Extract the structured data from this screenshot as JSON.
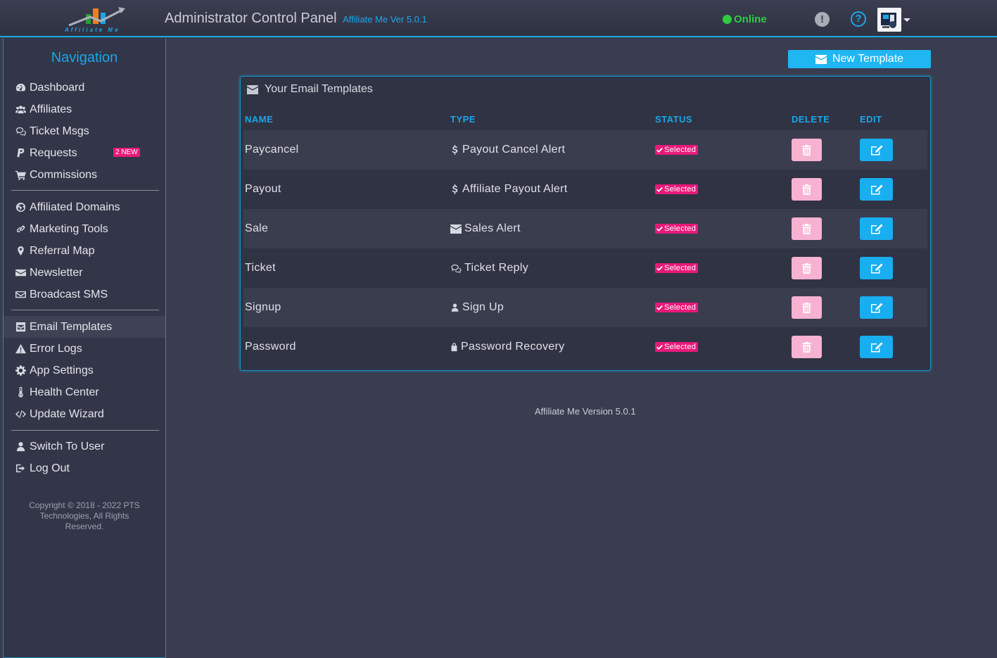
{
  "header": {
    "logo_text": "Affiliate Me",
    "title": "Administrator Control Panel",
    "version_label": "Affiliate Me Ver 5.0.1",
    "status": "Online",
    "status_color": "#2ecc40",
    "accent_color": "#1aa7e8"
  },
  "sidebar": {
    "title": "Navigation",
    "groups": [
      [
        {
          "label": "Dashboard",
          "icon": "dashboard-icon"
        },
        {
          "label": "Affiliates",
          "icon": "users-icon"
        },
        {
          "label": "Ticket Msgs",
          "icon": "comments-icon"
        },
        {
          "label": "Requests",
          "icon": "paypal-icon",
          "badge": "2 NEW"
        },
        {
          "label": "Commissions",
          "icon": "cart-icon"
        }
      ],
      [
        {
          "label": "Affiliated Domains",
          "icon": "globe-icon"
        },
        {
          "label": "Marketing Tools",
          "icon": "link-icon"
        },
        {
          "label": "Referral Map",
          "icon": "map-marker-icon"
        },
        {
          "label": "Newsletter",
          "icon": "envelope-icon"
        },
        {
          "label": "Broadcast SMS",
          "icon": "envelope-outline-icon"
        }
      ],
      [
        {
          "label": "Email Templates",
          "icon": "envelope-square-icon",
          "active": true
        },
        {
          "label": "Error Logs",
          "icon": "warning-icon"
        },
        {
          "label": "App Settings",
          "icon": "cog-icon"
        },
        {
          "label": "Health Center",
          "icon": "thermometer-icon"
        },
        {
          "label": "Update Wizard",
          "icon": "code-icon"
        }
      ],
      [
        {
          "label": "Switch To User",
          "icon": "user-icon"
        },
        {
          "label": "Log Out",
          "icon": "sign-out-icon"
        }
      ]
    ],
    "copyright": "Copyright © 2018 - 2022 PTS Technologies, All Rights Reserved."
  },
  "main": {
    "new_template_label": "New Template",
    "panel_title": "Your Email Templates",
    "columns": [
      "NAME",
      "TYPE",
      "STATUS",
      "DELETE",
      "EDIT"
    ],
    "rows": [
      {
        "name": "Paycancel",
        "type": "Payout Cancel Alert",
        "type_icon": "dollar-icon",
        "status": "Selected"
      },
      {
        "name": "Payout",
        "type": "Affiliate Payout Alert",
        "type_icon": "dollar-icon",
        "status": "Selected"
      },
      {
        "name": "Sale",
        "type": "Sales Alert",
        "type_icon": "envelope-icon",
        "status": "Selected"
      },
      {
        "name": "Ticket",
        "type": "Ticket Reply",
        "type_icon": "comments-icon",
        "status": "Selected"
      },
      {
        "name": "Signup",
        "type": "Sign Up",
        "type_icon": "user-icon",
        "status": "Selected"
      },
      {
        "name": "Password",
        "type": "Password Recovery",
        "type_icon": "lock-icon",
        "status": "Selected"
      }
    ],
    "footer": "Affiliate Me Version 5.0.1"
  }
}
